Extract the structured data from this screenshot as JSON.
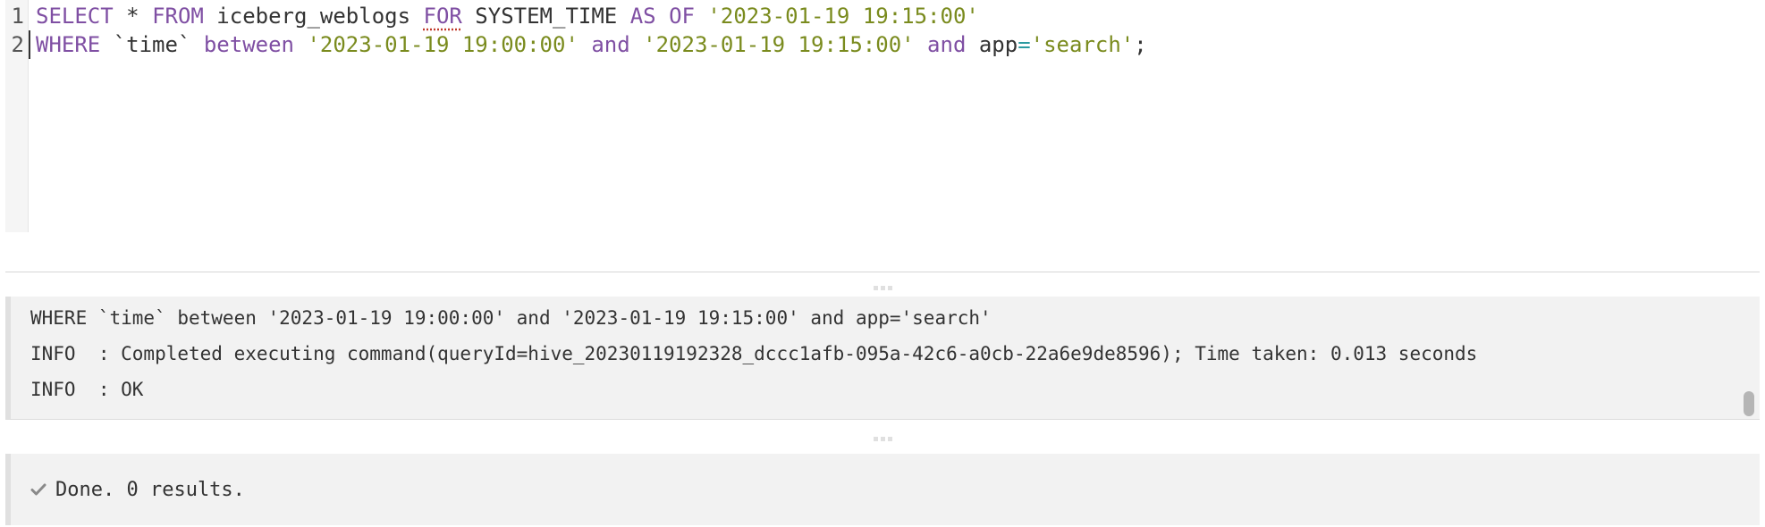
{
  "editor": {
    "line_numbers": [
      "1",
      "2"
    ],
    "line1": {
      "t1": "SELECT",
      "t2": " * ",
      "t3": "FROM",
      "t4": " iceberg_weblogs ",
      "t5": "FOR",
      "t6": " SYSTEM_TIME ",
      "t7": "AS",
      "t8": " ",
      "t9": "OF",
      "t10": " ",
      "t11": "'2023-01-19 19:15:00'"
    },
    "line2": {
      "t1": "WHERE",
      "t2": " `time` ",
      "t3": "between",
      "t4": " ",
      "t5": "'2023-01-19 19:00:00'",
      "t6": " ",
      "t7": "and",
      "t8": " ",
      "t9": "'2023-01-19 19:15:00'",
      "t10": " ",
      "t11": "and",
      "t12": " app",
      "t13": "=",
      "t14": "'search'",
      "t15": ";"
    }
  },
  "log": {
    "lines": [
      "WHERE `time` between '2023-01-19 19:00:00' and '2023-01-19 19:15:00' and app='search'",
      "INFO  : Completed executing command(queryId=hive_20230119192328_dccc1afb-095a-42c6-a0cb-22a6e9de8596); Time taken: 0.013 seconds",
      "INFO  : OK"
    ]
  },
  "result": {
    "icon": "check-icon",
    "text": "Done. 0 results."
  },
  "colors": {
    "keyword": "#7f4fa3",
    "string": "#7a8b1e",
    "operator": "#2c9aa0",
    "text": "#333333",
    "panel_bg": "#f2f2f2"
  }
}
